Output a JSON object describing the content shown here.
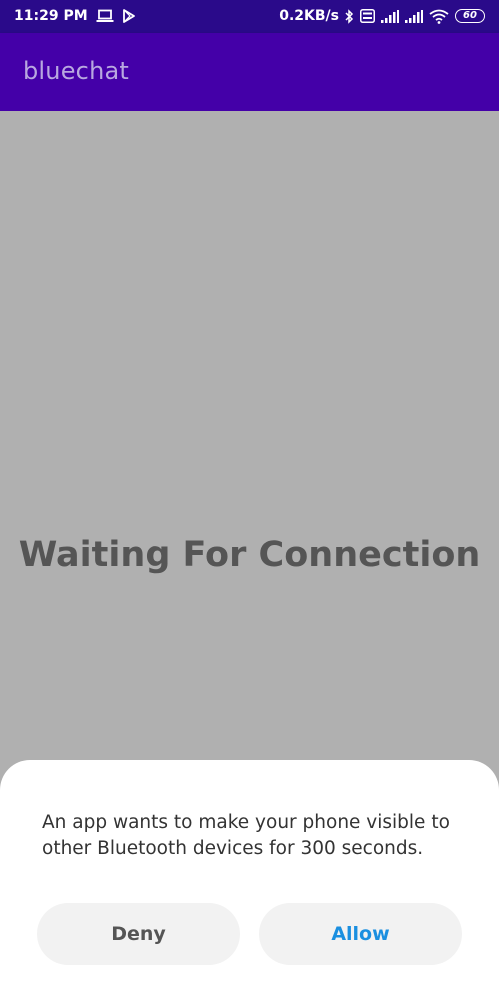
{
  "status_bar": {
    "time": "11:29 PM",
    "net_speed": "0.2KB/s",
    "battery": "60"
  },
  "app_bar": {
    "title": "bluechat"
  },
  "main": {
    "status_text": "Waiting For Connection"
  },
  "dialog": {
    "message": "An app wants to make your phone visible to other Bluetooth devices for 300 seconds.",
    "deny_label": "Deny",
    "allow_label": "Allow"
  },
  "colors": {
    "status_bar_bg": "#2a0a8a",
    "app_bar_bg": "#4400a8",
    "app_title": "#b8a8e0",
    "scrim": "#b0b0b0",
    "allow_text": "#1a8fe0"
  },
  "icons": [
    "laptop-icon",
    "play-store-icon",
    "bluetooth-icon",
    "volte-icon",
    "signal-icon",
    "wifi-icon",
    "battery-icon"
  ]
}
